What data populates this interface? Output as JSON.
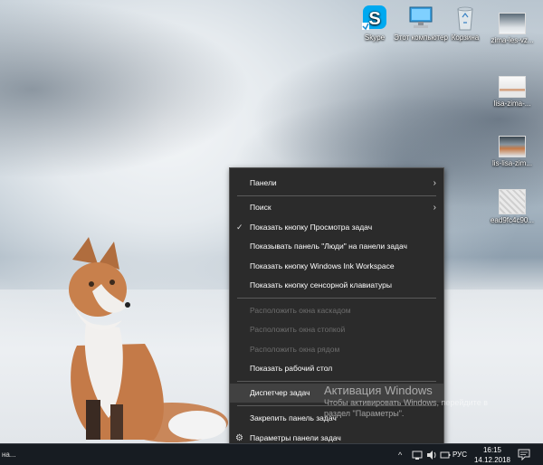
{
  "desktop_icons": [
    {
      "label": "Skype",
      "icon": "skype-icon"
    },
    {
      "label": "Этот компьютер",
      "icon": "computer-icon"
    },
    {
      "label": "Корзина",
      "icon": "recycle-bin-icon"
    },
    {
      "label": "zima-les-vz...",
      "icon": "image-file-icon"
    },
    {
      "label": "lisa-zima-...",
      "icon": "image-file-icon"
    },
    {
      "label": "lis-lisa-zim...",
      "icon": "image-file-icon"
    },
    {
      "label": "ead9fc4c90...",
      "icon": "image-file-icon"
    }
  ],
  "context_menu": {
    "items": [
      {
        "label": "Панели",
        "submenu": true
      },
      {
        "label": "Поиск",
        "submenu": true
      },
      {
        "label": "Показать кнопку Просмотра задач",
        "checked": true
      },
      {
        "label": "Показывать панель \"Люди\" на панели задач"
      },
      {
        "label": "Показать кнопку Windows Ink Workspace"
      },
      {
        "label": "Показать кнопку сенсорной клавиатуры"
      },
      {
        "label": "Расположить окна каскадом",
        "disabled": true
      },
      {
        "label": "Расположить окна стопкой",
        "disabled": true
      },
      {
        "label": "Расположить окна рядом",
        "disabled": true
      },
      {
        "label": "Показать рабочий стол"
      },
      {
        "label": "Диспетчер задач",
        "highlighted": true
      },
      {
        "label": "Закрепить панель задач"
      },
      {
        "label": "Параметры панели задач",
        "icon": "gear-icon"
      }
    ],
    "symbols": {
      "arrow": "›",
      "check": "✓",
      "gear": "⚙"
    }
  },
  "activation": {
    "title": "Активация Windows",
    "subtitle_line1": "Чтобы активировать Windows, перейдите в",
    "subtitle_line2": "раздел \"Параметры\"."
  },
  "taskbar": {
    "left_text": "на...",
    "tray_chevron": "^",
    "language": "РУС",
    "time": "16:15",
    "date": "14.12.2018"
  },
  "colors": {
    "menu_bg": "#2b2b2b",
    "menu_hover": "#414141",
    "taskbar_bg": "#171c22",
    "skype_blue": "#00a9f0"
  }
}
